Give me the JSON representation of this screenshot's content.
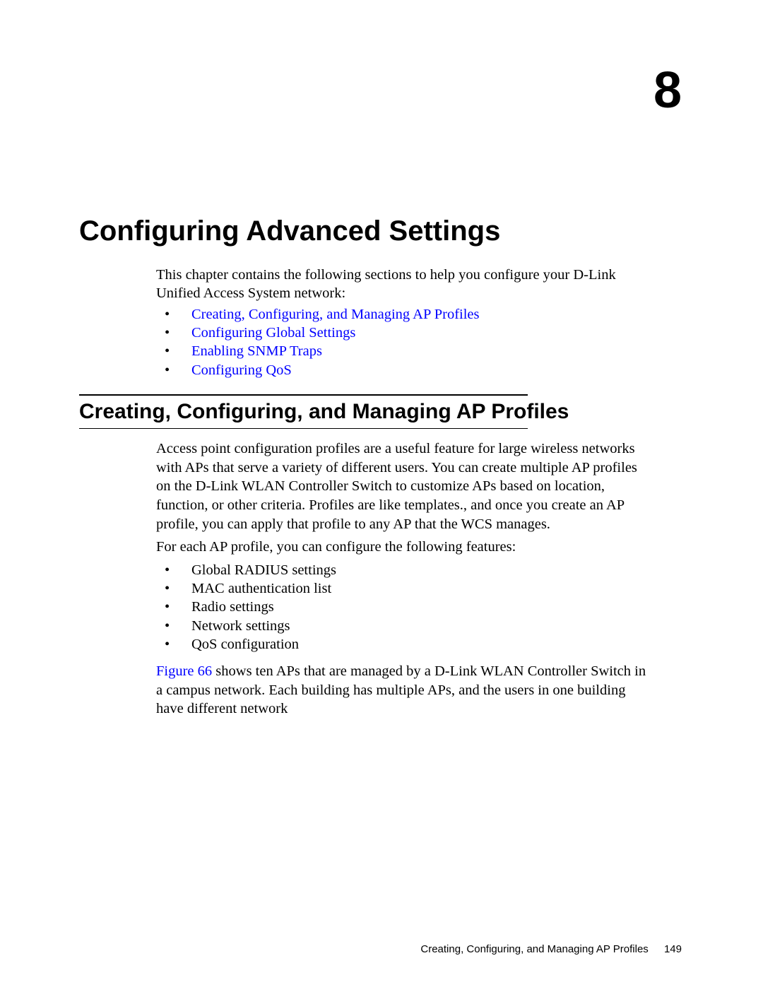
{
  "chapter": {
    "number": "8",
    "title": "Configuring Advanced Settings"
  },
  "intro": "This chapter contains the following sections to help you configure your D-Link Unified Access System network:",
  "toc_links": [
    "Creating, Configuring, and Managing AP Profiles",
    "Configuring Global Settings",
    "Enabling SNMP Traps",
    "Configuring QoS"
  ],
  "section1": {
    "heading": "Creating, Configuring, and Managing AP Profiles",
    "para1": "Access point configuration profiles are a useful feature for large wireless networks with APs that serve a variety of different users. You can create multiple AP profiles on the D-Link WLAN Controller Switch to customize APs based on location, function, or other criteria. Profiles are like templates., and once you create an AP profile, you can apply that profile to any AP that the WCS manages.",
    "para2": "For each AP profile, you can configure the following features:",
    "features": [
      "Global RADIUS settings",
      "MAC authentication list",
      "Radio settings",
      "Network settings",
      "QoS configuration"
    ],
    "figref": "Figure 66",
    "para3_tail": " shows ten APs that are managed by a D-Link WLAN Controller Switch in a campus network. Each building has multiple APs, and the users in one building have different network"
  },
  "footer": {
    "section": "Creating, Configuring, and Managing AP Profiles",
    "page": "149"
  }
}
